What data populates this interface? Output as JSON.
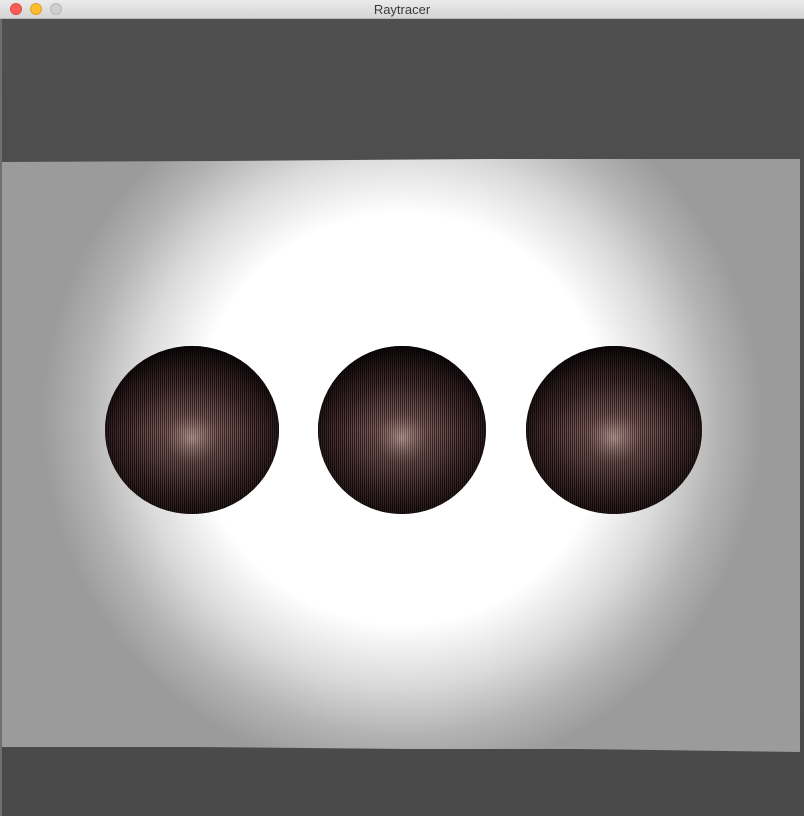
{
  "window": {
    "title": "Raytracer"
  },
  "scene": {
    "background_color": "#4b4b4b",
    "floor_color": "#9a9a9a",
    "glow_color": "#ffffff",
    "sphere_count": 3,
    "sphere_base_color": "#1d1112",
    "sphere_highlight_color": "#d8b2aa"
  }
}
